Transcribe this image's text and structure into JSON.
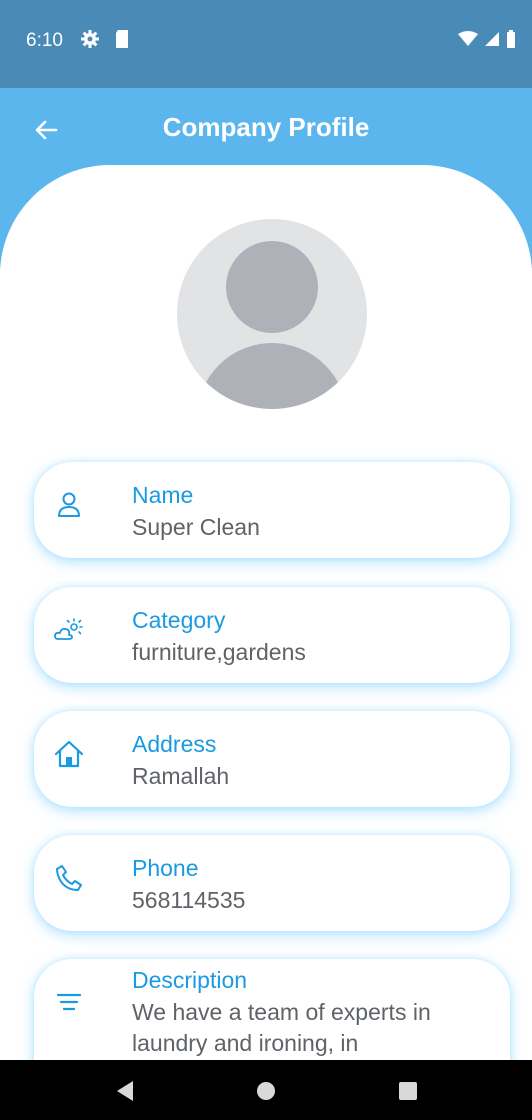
{
  "status_bar": {
    "time": "6:10"
  },
  "app_bar": {
    "title": "Company Profile"
  },
  "fields": {
    "name": {
      "label": "Name",
      "value": "Super Clean"
    },
    "category": {
      "label": "Category",
      "value": "furniture,gardens"
    },
    "address": {
      "label": "Address",
      "value": "Ramallah"
    },
    "phone": {
      "label": "Phone",
      "value": "568114535"
    },
    "description": {
      "label": "Description",
      "value": "We have a team of experts in laundry and ironing, in"
    }
  },
  "colors": {
    "status_bar": "#4a8ab7",
    "app_bar": "#5cb6ee",
    "label": "#1a9ae0",
    "value": "#5f6368"
  },
  "icons": [
    "back-arrow-icon",
    "person-icon",
    "cloud-sun-icon",
    "home-icon",
    "phone-icon",
    "menu-lines-icon"
  ]
}
